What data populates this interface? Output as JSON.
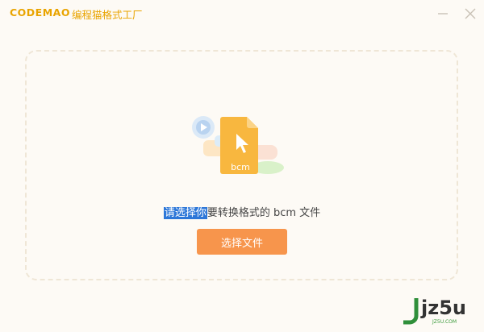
{
  "app": {
    "brand": "CODEMAO",
    "subtitle": "· 编程猫格式工厂"
  },
  "window_controls": {
    "minimize": "minimize",
    "close": "close"
  },
  "main": {
    "file_icon_label": "bcm",
    "hint_selected": "请选择你",
    "hint_rest": "要转换格式的 bcm 文件",
    "select_button": "选择文件"
  },
  "watermark": {
    "text": "jz5u",
    "sub": "JZ5U.COM"
  },
  "colors": {
    "accent": "#f7954c",
    "brand": "#e9a400",
    "file_icon": "#f8b73f",
    "selection": "#2d77d8"
  }
}
